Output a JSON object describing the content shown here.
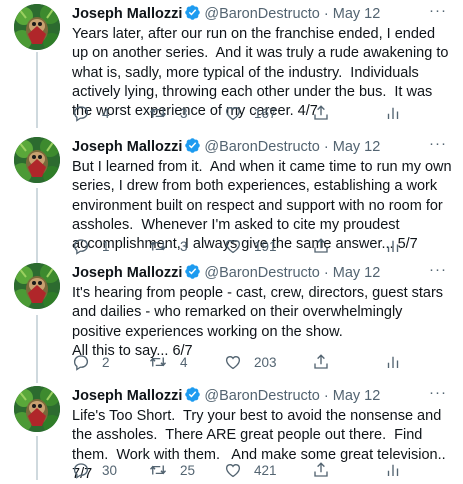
{
  "tweets": [
    {
      "name": "Joseph Mallozzi",
      "handle": "@BaronDestructo",
      "dot": "·",
      "date": "May 12",
      "text": "Years later, after our run on the franchise ended, I ended up on another series.  And it was truly a rude awakening to what is, sadly, more typical of the industry.  Individuals actively lying, throwing each other under the bus.  It was the worst experience of my career. 4/7",
      "replies": "4",
      "retweets": "3",
      "likes": "167"
    },
    {
      "name": "Joseph Mallozzi",
      "handle": "@BaronDestructo",
      "dot": "·",
      "date": "May 12",
      "text": "But I learned from it.  And when it came time to run my own series, I drew from both experiences, establishing a work environment built on respect and support with no room for assholes.  Whenever I'm asked to cite my proudest accomplishment, I always give the same answer... 5/7",
      "replies": "1",
      "retweets": "3",
      "likes": "191"
    },
    {
      "name": "Joseph Mallozzi",
      "handle": "@BaronDestructo",
      "dot": "·",
      "date": "May 12",
      "text": "It's hearing from people - cast, crew, directors, guest stars and dailies - who remarked on their overwhelmingly positive experiences working on the show.\nAll this to say... 6/7",
      "replies": "2",
      "retweets": "4",
      "likes": "203"
    },
    {
      "name": "Joseph Mallozzi",
      "handle": "@BaronDestructo",
      "dot": "·",
      "date": "May 12",
      "text": "Life's Too Short.  Try your best to avoid the nonsense and the assholes.  There ARE great people out there.  Find them.  Work with them.   And make some great television.. 7/7",
      "replies": "30",
      "retweets": "25",
      "likes": "421"
    }
  ],
  "more_glyph": "···",
  "colors": {
    "text": "#0f1419",
    "secondary": "#536471",
    "verified": "#1d9bf0",
    "thread_line": "#cfd9de"
  },
  "icons": [
    "verified-badge-icon",
    "more-icon",
    "reply-icon",
    "retweet-icon",
    "like-icon",
    "share-icon",
    "analytics-icon"
  ]
}
